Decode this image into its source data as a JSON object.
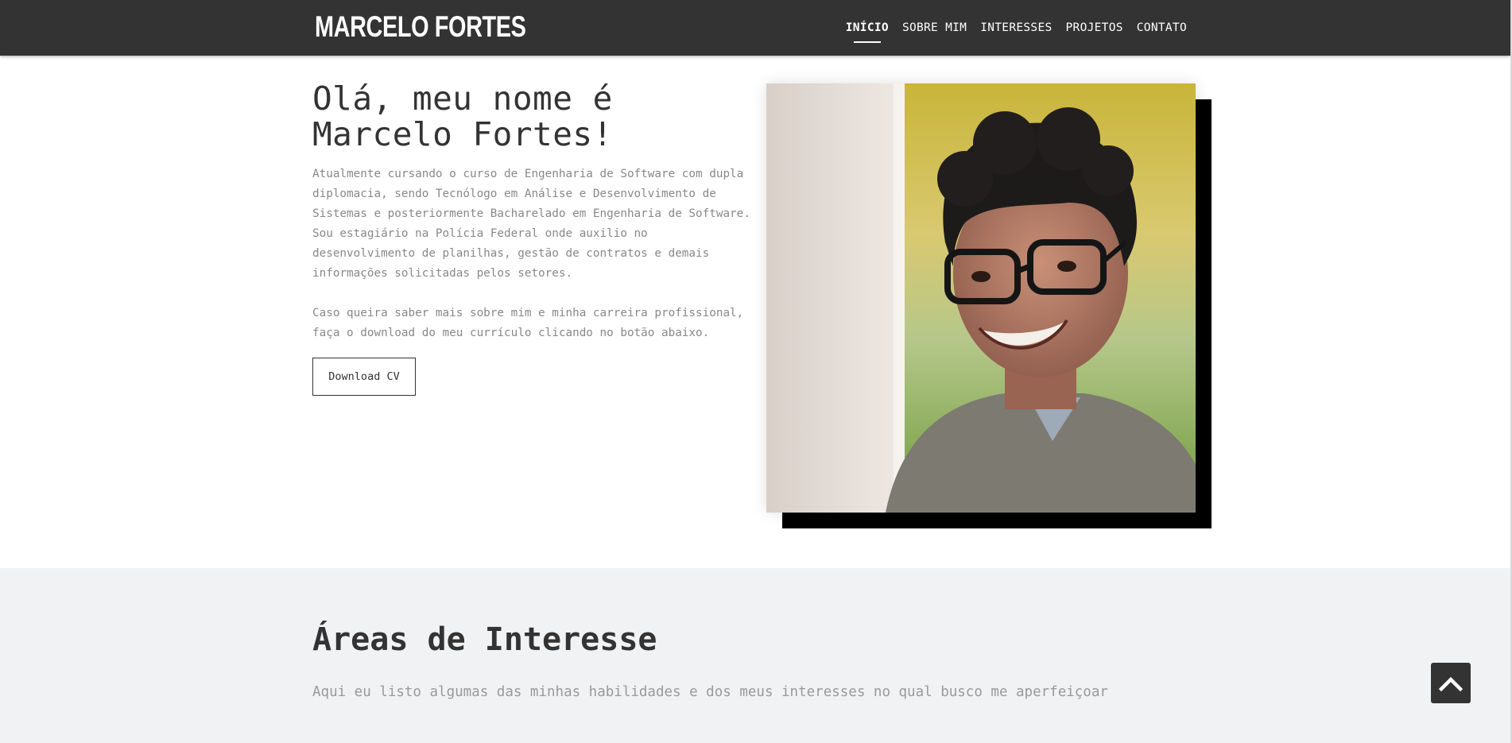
{
  "header": {
    "brand": "MARCELO FORTES",
    "nav": [
      {
        "label": "INÍCIO",
        "active": true
      },
      {
        "label": "SOBRE MIM",
        "active": false
      },
      {
        "label": "INTERESSES",
        "active": false
      },
      {
        "label": "PROJETOS",
        "active": false
      },
      {
        "label": "CONTATO",
        "active": false
      }
    ]
  },
  "hero": {
    "title": "Olá, meu nome é Marcelo Fortes!",
    "paragraph1": "Atualmente cursando o curso de Engenharia de Software com dupla diplomacia, sendo Tecnólogo em Análise e Desenvolvimento de Sistemas e posteriormente Bacharelado em Engenharia de Software. Sou estagiário na Polícia Federal onde auxilio no desenvolvimento de planilhas, gestão de contratos e demais informações solicitadas pelos setores.",
    "paragraph2": "Caso queira saber mais sobre mim e minha carreira profissional, faça o download do meu currículo clicando no botão abaixo.",
    "button_label": "Download CV"
  },
  "interests": {
    "title": "Áreas de Interesse",
    "subtitle": "Aqui eu listo algumas das minhas habilidades e dos meus interesses no qual busco me aperfeiçoar"
  },
  "icons": {
    "back_to_top": "chevron-up-icon"
  },
  "colors": {
    "header_bg": "#333333",
    "section_bg": "#f1f2f4",
    "text_muted": "#888888"
  }
}
